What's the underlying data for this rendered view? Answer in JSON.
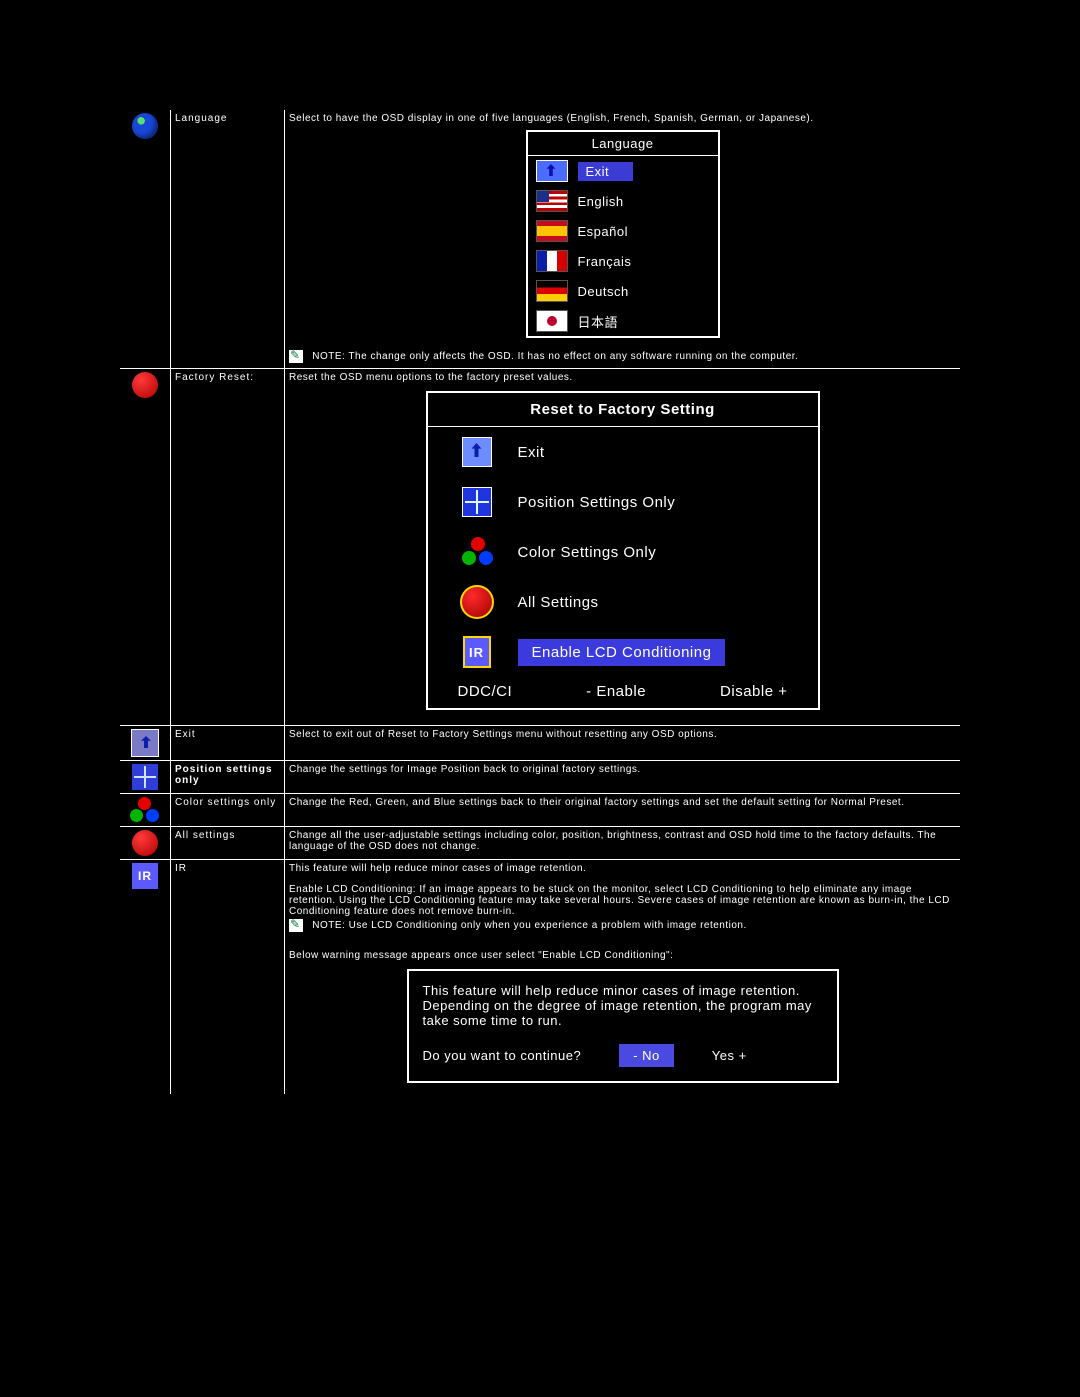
{
  "rows": {
    "language": {
      "label": "Language",
      "desc": "Select to have the OSD display in one of five languages (English, French, Spanish, German, or Japanese).",
      "note": "NOTE: The change only affects the OSD. It has no effect on any software running on the computer."
    },
    "factory": {
      "label": "Factory Reset:",
      "desc": "Reset the OSD menu options to  the factory preset values."
    },
    "exit": {
      "label": "Exit",
      "desc": "Select to exit out of Reset to Factory Settings menu without resetting any OSD options."
    },
    "position": {
      "label": "Position settings only",
      "desc": "Change the settings for Image Position back to original factory settings."
    },
    "color": {
      "label": "Color settings only",
      "desc": "Change the Red, Green, and Blue settings back to their original factory settings and set  the default setting for Normal Preset."
    },
    "all": {
      "label": "All settings",
      "desc": "Change all the user-adjustable settings including color, position, brightness, contrast and OSD hold time  to the factory defaults. The language of the OSD does not change."
    },
    "ir": {
      "label": "IR",
      "desc1": "This feature will help reduce minor cases of image retention.",
      "desc2": "Enable LCD Conditioning: If an image appears to be stuck on the monitor, select LCD Conditioning to help eliminate any image retention. Using the LCD Conditioning feature may take several hours. Severe cases of image retention are known as burn-in, the LCD Conditioning feature does not remove burn-in.",
      "note": "NOTE: Use LCD Conditioning only when you experience a problem with image retention.",
      "below": "Below warning message appears once user select \"Enable LCD Conditioning\":"
    }
  },
  "osd_language": {
    "title": "Language",
    "items": {
      "exit": "Exit",
      "en": "English",
      "es": "Español",
      "fr": "Français",
      "de": "Deutsch",
      "jp": "日本語"
    }
  },
  "osd_factory": {
    "title": "Reset to Factory Setting",
    "items": {
      "exit": "Exit",
      "pos": "Position Settings Only",
      "color": "Color Settings Only",
      "all": "All Settings",
      "ir": "Enable LCD Conditioning"
    },
    "ddc_label": "DDC/CI",
    "enable": "- Enable",
    "disable": "Disable +",
    "ir_tile": "IR"
  },
  "osd_warning": {
    "body": "This feature will help reduce minor cases of image retention. Depending on the degree of image retention, the program may take some time to run.",
    "prompt": "Do you want to continue?",
    "no": "- No",
    "yes": "Yes +"
  },
  "ir_tile_small": "IR"
}
